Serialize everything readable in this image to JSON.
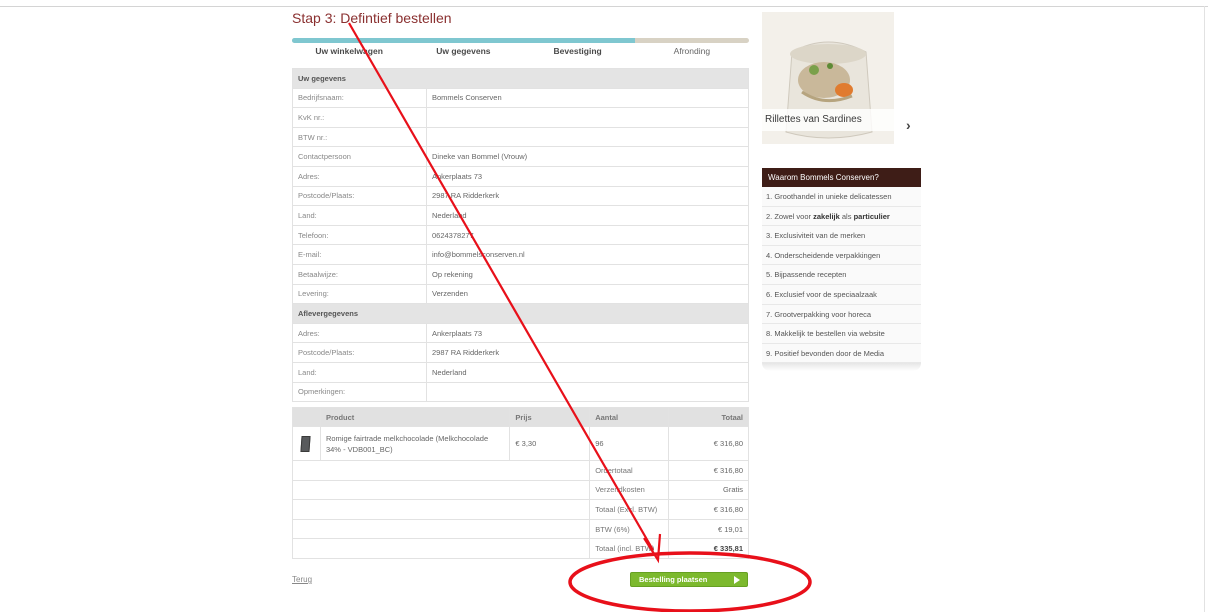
{
  "page": {
    "title": "Stap 3: Defintief bestellen"
  },
  "progress": {
    "fraction": 0.75,
    "steps": [
      {
        "label": "Uw winkelwagen",
        "active": true
      },
      {
        "label": "Uw gegevens",
        "active": true
      },
      {
        "label": "Bevestiging",
        "active": true
      },
      {
        "label": "Afronding",
        "active": false
      }
    ]
  },
  "customer": {
    "section_title": "Uw gegevens",
    "rows": [
      {
        "label": "Bedrijfsnaam:",
        "value": "Bommels Conserven"
      },
      {
        "label": "KvK nr.:",
        "value": ""
      },
      {
        "label": "BTW nr.:",
        "value": ""
      },
      {
        "label": "Contactpersoon",
        "value": "Dineke van Bommel (Vrouw)"
      },
      {
        "label": "Adres:",
        "value": "Ankerplaats 73"
      },
      {
        "label": "Postcode/Plaats:",
        "value": "2987 RA Ridderkerk"
      },
      {
        "label": "Land:",
        "value": "Nederland"
      },
      {
        "label": "Telefoon:",
        "value": "0624378277"
      },
      {
        "label": "E-mail:",
        "value": "info@bommelsconserven.nl"
      },
      {
        "label": "Betaalwijze:",
        "value": "Op rekening"
      },
      {
        "label": "Levering:",
        "value": "Verzenden"
      }
    ]
  },
  "delivery": {
    "section_title": "Aflevergegevens",
    "rows": [
      {
        "label": "Adres:",
        "value": "Ankerplaats 73"
      },
      {
        "label": "Postcode/Plaats:",
        "value": "2987 RA Ridderkerk"
      },
      {
        "label": "Land:",
        "value": "Nederland"
      },
      {
        "label": "Opmerkingen:",
        "value": ""
      }
    ]
  },
  "order": {
    "headers": {
      "product": "Product",
      "price": "Prijs",
      "qty": "Aantal",
      "total": "Totaal"
    },
    "items": [
      {
        "name": "Romige fairtrade melkchocolade (Melkchocolade 34% - VDB001_BC)",
        "price": "€ 3,30",
        "qty": "96",
        "total": "€ 316,80"
      }
    ],
    "summary": [
      {
        "label": "Ordertotaal",
        "value": "€ 316,80",
        "bold": false
      },
      {
        "label": "Verzendkosten",
        "value": "Gratis",
        "bold": false
      },
      {
        "label": "Totaal (Excl. BTW)",
        "value": "€ 316,80",
        "bold": false
      },
      {
        "label": "BTW (6%)",
        "value": "€ 19,01",
        "bold": false
      },
      {
        "label": "Totaal (incl. BTW)",
        "value": "€ 335,81",
        "bold": true
      }
    ]
  },
  "actions": {
    "back": "Terug",
    "place_order": "Bestelling plaatsen"
  },
  "promo": {
    "caption": "Rillettes van Sardines",
    "next_icon": "chevron-right"
  },
  "why": {
    "title": "Waarom Bommels Conserven?",
    "items": [
      "1. Groothandel in unieke delicatessen",
      "2. Zowel voor zakelijk als particulier",
      "3. Exclusiviteit van de merken",
      "4. Onderscheidende verpakkingen",
      "5. Bijpassende recepten",
      "6. Exclusief voor de speciaalzaak",
      "7. Grootverpakking voor horeca",
      "8. Makkelijk te bestellen via website",
      "9. Positief bevonden door de Media"
    ]
  },
  "annotation_color": "#e8101a"
}
